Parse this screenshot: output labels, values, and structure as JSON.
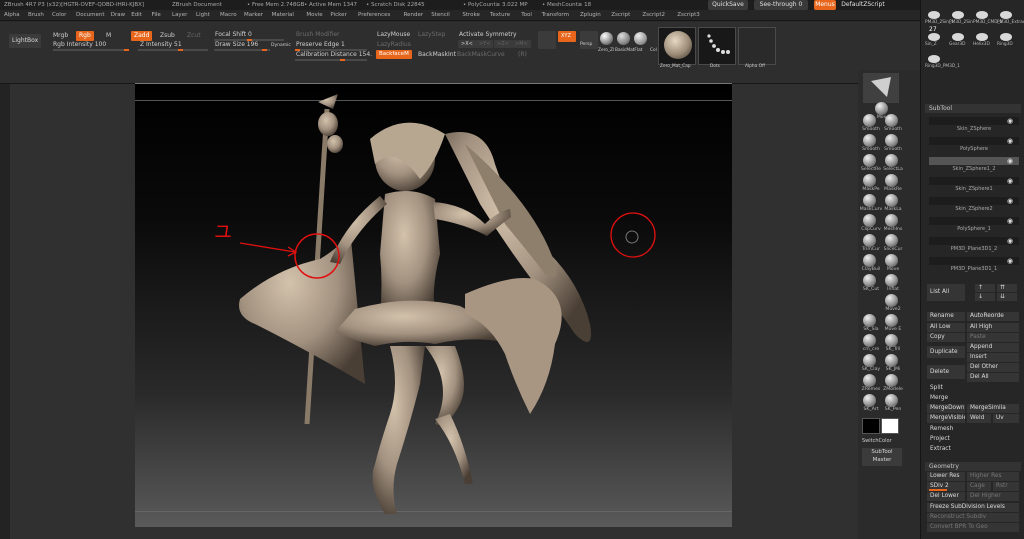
{
  "titlebar": {
    "app": "ZBrush 4R7 P3 (x32)[HGTR-OVEF-QOBD-IHRI-KJBX]",
    "doc": "ZBrush Document",
    "free_mem": "• Free Mem 2.748GB",
    "active_mem": "• Active Mem 1347",
    "scratch": "• Scratch Disk 22845",
    "polycount": "• PolyCount≥ 3.022 MP",
    "meshcount": "• MeshCount≥ 18",
    "quicksave": "QuickSave",
    "seethrough": "See-through  0",
    "menus": "Menus",
    "zscript": "DefaultZScript"
  },
  "menubar": [
    "Alpha",
    "Brush",
    "Color",
    "Document",
    "Draw",
    "Edit",
    "File",
    "Layer",
    "Light",
    "Macro",
    "Marker",
    "Material",
    "Movie",
    "Picker",
    "Preferences",
    "Render",
    "Stencil",
    "Stroke",
    "Texture",
    "Tool",
    "Transform",
    "Zplugin",
    "Zscript",
    "Zscript2",
    "Zscript3"
  ],
  "toolbar": {
    "lightbox": "LightBox",
    "mrgb": "Mrgb",
    "rgb": "Rgb",
    "m": "M",
    "zadd": "Zadd",
    "zsub": "Zsub",
    "zcut": "Zcut",
    "rgb_intensity": "Rgb Intensity 100",
    "z_intensity": "Z Intensity 51",
    "focal_shift": "Focal Shift 0",
    "draw_size": "Draw Size 196",
    "dynamic": "Dynamic",
    "brush_modifier": "Brush Modifier",
    "preserve_edge": "Preserve Edge 1",
    "calibration": "Calibration Distance 154.",
    "lazymouse": "LazyMouse",
    "lazystep": "LazyStep",
    "lazyradius": "LazyRadius",
    "backface": "BackfaceM",
    "backmaskint": "BackMaskInt",
    "backmaskcurve": "BackMaskCurve",
    "activate_symmetry": "Activate Symmetry",
    "x": ">X<",
    "y": ">Y<",
    "z": ">Z<",
    "m2": ">M<",
    "r": "(R)",
    "radial": "RadialCount",
    "xyz": "XYZ",
    "persp": "Persp",
    "floor": "Floor",
    "local": "Local",
    "mat1": "Zero_Zl",
    "mat2": "BasicMatFlat",
    "mat3": "Col",
    "thumb1": "Zero_Mat_Cap",
    "thumb2": "Dots",
    "thumb3": "Alpha Off"
  },
  "rightshelf": [
    "Move",
    "Smooth",
    "Smooth",
    "Smooth",
    "Smooth",
    "SelectRe",
    "SelectLa",
    "MaskPe",
    "MaskRe",
    "MaskCurv",
    "MaskLa",
    "ClipCurv",
    "MeshIns",
    "TrimCur",
    "SliceCur",
    "ClayBuil",
    "Move",
    "SK_Cut",
    "Inflat",
    "Move2",
    "SK_Sla",
    "Move E",
    "cm_cre",
    "SK_Tril",
    "SK_Clay",
    "SK_JMi",
    "ZRemes",
    "ZModele",
    "SK_Art",
    "SK_Pen",
    "SwitchColor",
    "SubTool Master"
  ],
  "tool_palette": {
    "items": [
      "PM3D_2Sin_1",
      "PM3D_2Sin",
      "PM3D_CMD_1",
      "PM3D_Extract Slit_ZS",
      "Sin_Z",
      "Gear3D",
      "Helix3D",
      "Ring3D",
      "Ring3D_PM3D_1"
    ],
    "count": "27"
  },
  "subtool": {
    "header": "SubTool",
    "items": [
      {
        "name": "Skin_ZSphere"
      },
      {
        "name": "PolySphere"
      },
      {
        "name": "Skin_ZSphere1_2"
      },
      {
        "name": "Skin_ZSphere1"
      },
      {
        "name": "Skin_ZSphere2"
      },
      {
        "name": "PolySphere_1"
      },
      {
        "name": "PM3D_Plane3D1_2"
      },
      {
        "name": "PM3D_Plane3D1_1"
      }
    ],
    "list_all": "List All",
    "rename": "Rename",
    "autoreorder": "AutoReorde",
    "all_low": "All Low",
    "all_high": "All High",
    "copy": "Copy",
    "paste": "Paste",
    "append": "Append",
    "duplicate": "Duplicate",
    "insert": "Insert",
    "delete": "Delete",
    "del_other": "Del Other",
    "del_all": "Del All",
    "split": "Split",
    "merge": "Merge",
    "mergedown": "MergeDown",
    "mergesimilar": "MergeSimila",
    "mergevisible": "MergeVisible",
    "weld": "Weld",
    "uv": "Uv",
    "remesh": "Remesh",
    "project": "Project",
    "extract": "Extract"
  },
  "geometry": {
    "header": "Geometry",
    "lower_res": "Lower Res",
    "higher_res": "Higher Res",
    "sdiv": "SDiv 2",
    "cage": "Cage",
    "rstr": "Rstr",
    "del_lower": "Del Lower",
    "del_higher": "Del Higher",
    "freeze": "Freeze SubDivision Levels",
    "reconstruct": "Reconstruct Subdiv",
    "convert": "Convert BPR To Geo"
  },
  "annotation": {
    "handwritten": "ユ"
  },
  "colors": {
    "accent": "#e8661c",
    "annotation_red": "#e01010"
  }
}
